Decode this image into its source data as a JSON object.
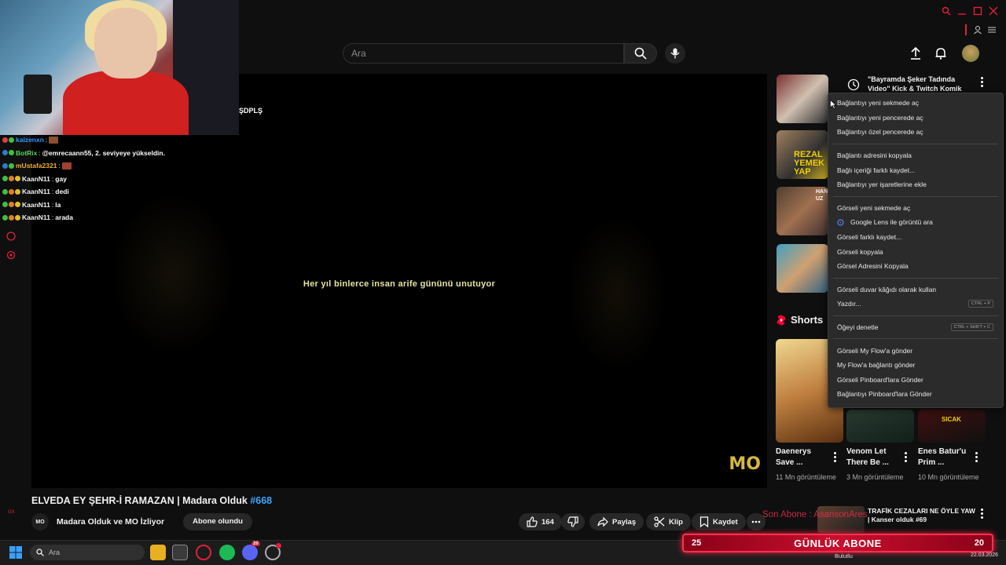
{
  "header": {
    "search_placeholder": "Ara",
    "icons": [
      "search-icon",
      "microphone-icon",
      "upload-icon",
      "bell-icon",
      "avatar"
    ]
  },
  "chat": {
    "lines": [
      {
        "user": "kaizenxn",
        "sep": " : ",
        "message": "",
        "user_color": "#2e9aff"
      },
      {
        "user": "BotRix",
        "sep": " : ",
        "message": "@emrecaann55, 2. seviyeye yükseldin.",
        "user_color": "#5ad15a"
      },
      {
        "user": "mUstafa2321",
        "sep": " : ",
        "message": "",
        "user_color": "#f0b030"
      },
      {
        "user": "KaanN11",
        "sep": " : ",
        "message": "gay",
        "user_color": "#fff"
      },
      {
        "user": "KaanN11",
        "sep": " : ",
        "message": "dedi",
        "user_color": "#fff"
      },
      {
        "user": "KaanN11",
        "sep": " : ",
        "message": "la",
        "user_color": "#fff"
      },
      {
        "user": "KaanN11",
        "sep": " : ",
        "message": "arada",
        "user_color": "#fff"
      }
    ]
  },
  "video": {
    "subtitle": "Her yıl binlerce insan arife gününü unutuyor",
    "watermark": "MO",
    "ticker": "ŞDPLŞ",
    "title": "ELVEDA EY ŞEHR-İ RAMAZAN | Madara Olduk ",
    "title_tag": "#668",
    "channel_avatar_text": "MO",
    "channel_name": "Madara Olduk ve MO İzliyor",
    "subscribed_label": "Abone olundu",
    "like_count": "164",
    "share_label": "Paylaş",
    "clip_label": "Klip",
    "save_label": "Kaydet"
  },
  "recommendations": {
    "first_title": "\"Bayramda Şeker Tadında Video\" Kick & Twitch Komik",
    "bottom_title": "TRAFİK CEZALARI NE ÖYLE YAW | Kanser olduk #69",
    "thumb_texts": [
      "",
      "REZAL YEMEK YAP",
      "HAN UZ",
      ""
    ]
  },
  "shorts": {
    "header": "Shorts",
    "items": [
      {
        "title": "Daenerys Save ...",
        "views": "11 Mn görüntüleme"
      },
      {
        "title": "Venom Let There Be ...",
        "views": "3 Mn görüntüleme"
      },
      {
        "title": "Enes Batur'u Prim ...",
        "views": "10 Mn görüntüleme"
      }
    ],
    "third_thumb_text": "SICAK"
  },
  "context_menu": {
    "groups": [
      [
        {
          "label": "Bağlantıyı yeni sekmede aç"
        },
        {
          "label": "Bağlantıyı yeni pencerede aç"
        },
        {
          "label": "Bağlantıyı özel pencerede aç"
        }
      ],
      [
        {
          "label": "Bağlantı adresini kopyala"
        },
        {
          "label": "Bağlı içeriği farklı kaydet..."
        },
        {
          "label": "Bağlantıyı yer işaretlerine ekle"
        }
      ],
      [
        {
          "label": "Görseli yeni sekmede aç"
        },
        {
          "label": "Google Lens ile görüntü ara",
          "icon": "google-lens-icon"
        },
        {
          "label": "Görseli farklı kaydet..."
        },
        {
          "label": "Görseli kopyala"
        },
        {
          "label": "Görsel Adresini Kopyala"
        }
      ],
      [
        {
          "label": "Görseli duvar kâğıdı olarak kullan"
        },
        {
          "label": "Yazdır...",
          "shortcut": "CTRL + P"
        }
      ],
      [
        {
          "label": "Öğeyi denetle",
          "shortcut": "CTRL + SHIFT + C"
        }
      ],
      [
        {
          "label": "Görseli My Flow'a gönder"
        },
        {
          "label": "My Flow'a bağlantı gönder"
        },
        {
          "label": "Görseli Pinboard'lara Gönder"
        },
        {
          "label": "Bağlantıyı Pinboard'lara Gönder"
        }
      ]
    ]
  },
  "overlay": {
    "abone_left": "25",
    "abone_label": "GÜNLÜK ABONE",
    "abone_right": "20",
    "scroll_text": "Son Abone : AsansonAres"
  },
  "taskbar": {
    "search_placeholder": "Ara",
    "weather": "Bulutlu",
    "date": "22.03.2026",
    "discord_badge": "20"
  },
  "colors": {
    "accent_red": "#ff0033",
    "link_blue": "#3ea6ff",
    "bg": "#0f0f0f"
  }
}
